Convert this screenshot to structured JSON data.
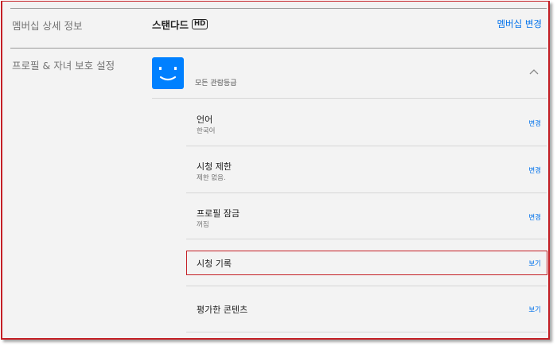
{
  "membership": {
    "section_label": "멤버십 상세 정보",
    "plan_name": "스탠다드",
    "plan_badge": "HD",
    "change_link": "멤버십 변경"
  },
  "profile": {
    "section_label": "프로필 & 자녀 보호 설정",
    "avatar_color": "#0080ff",
    "rating_text": "모든 관람등급",
    "rows": [
      {
        "title": "언어",
        "subtitle": "한국어",
        "action": "변경"
      },
      {
        "title": "시청 제한",
        "subtitle": "제한 없음.",
        "action": "변경"
      },
      {
        "title": "프로필 잠금",
        "subtitle": "꺼짐",
        "action": "변경"
      },
      {
        "title": "시청 기록",
        "subtitle": "",
        "action": "보기"
      },
      {
        "title": "평가한 콘텐츠",
        "subtitle": "",
        "action": "보기"
      }
    ]
  },
  "colors": {
    "accent_link": "#0071eb",
    "highlight_border": "#c41f25",
    "page_background": "#f3f3f3"
  },
  "icons": {
    "avatar": "smiley-face-icon",
    "expand": "chevron-up-icon"
  }
}
